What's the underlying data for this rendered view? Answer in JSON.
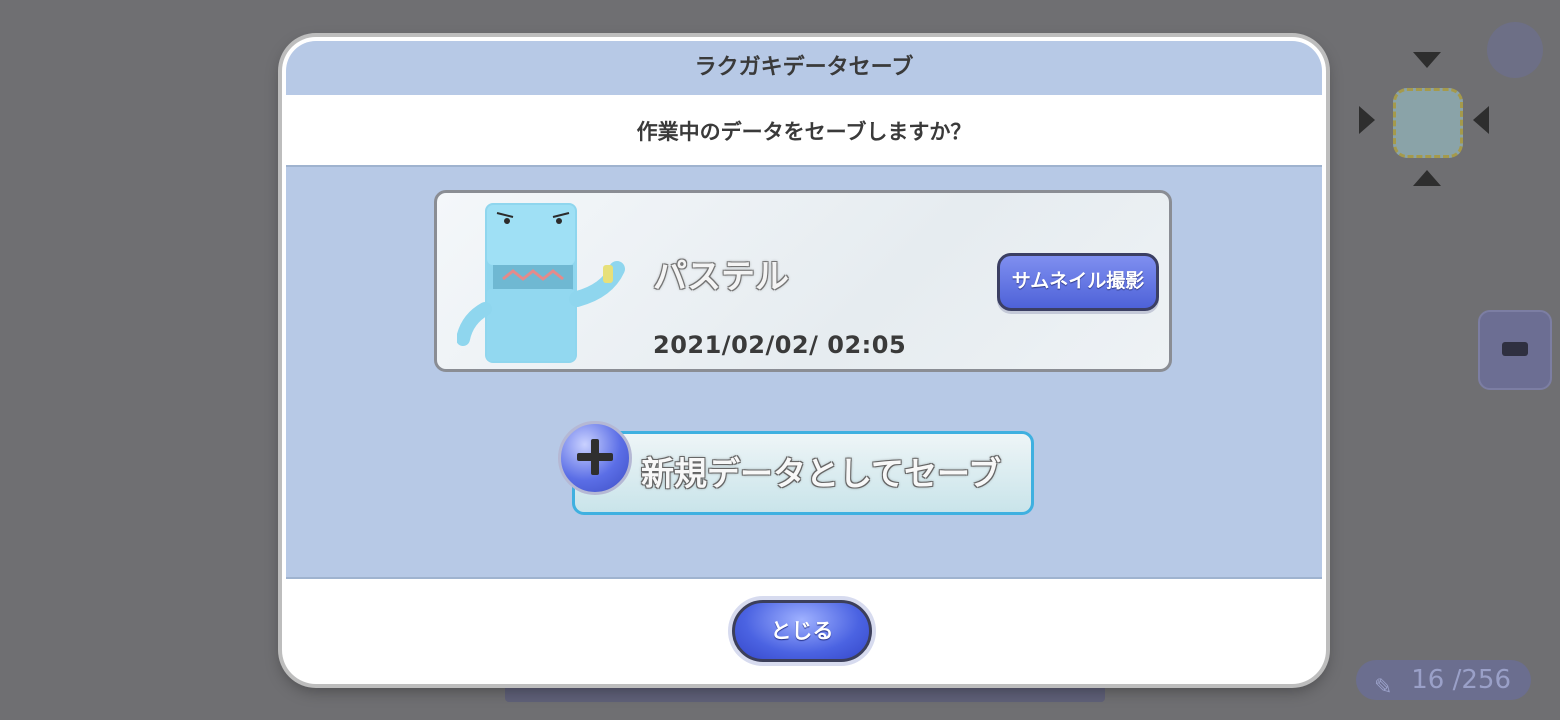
{
  "dialog": {
    "title": "ラクガキデータセーブ",
    "question": "作業中のデータをセーブしますか？",
    "save_slot": {
      "name": "パステル",
      "date": "2021/02/02/ 02:05",
      "thumbnail_button": "サムネイル撮影"
    },
    "new_save_button": "新規データとしてセーブ",
    "close_button": "とじる"
  },
  "background": {
    "counter": "16 /256"
  },
  "colors": {
    "header_bg": "#b7c9e6",
    "accent_blue": "#4e62d8",
    "new_save_border": "#3fb0e0"
  }
}
